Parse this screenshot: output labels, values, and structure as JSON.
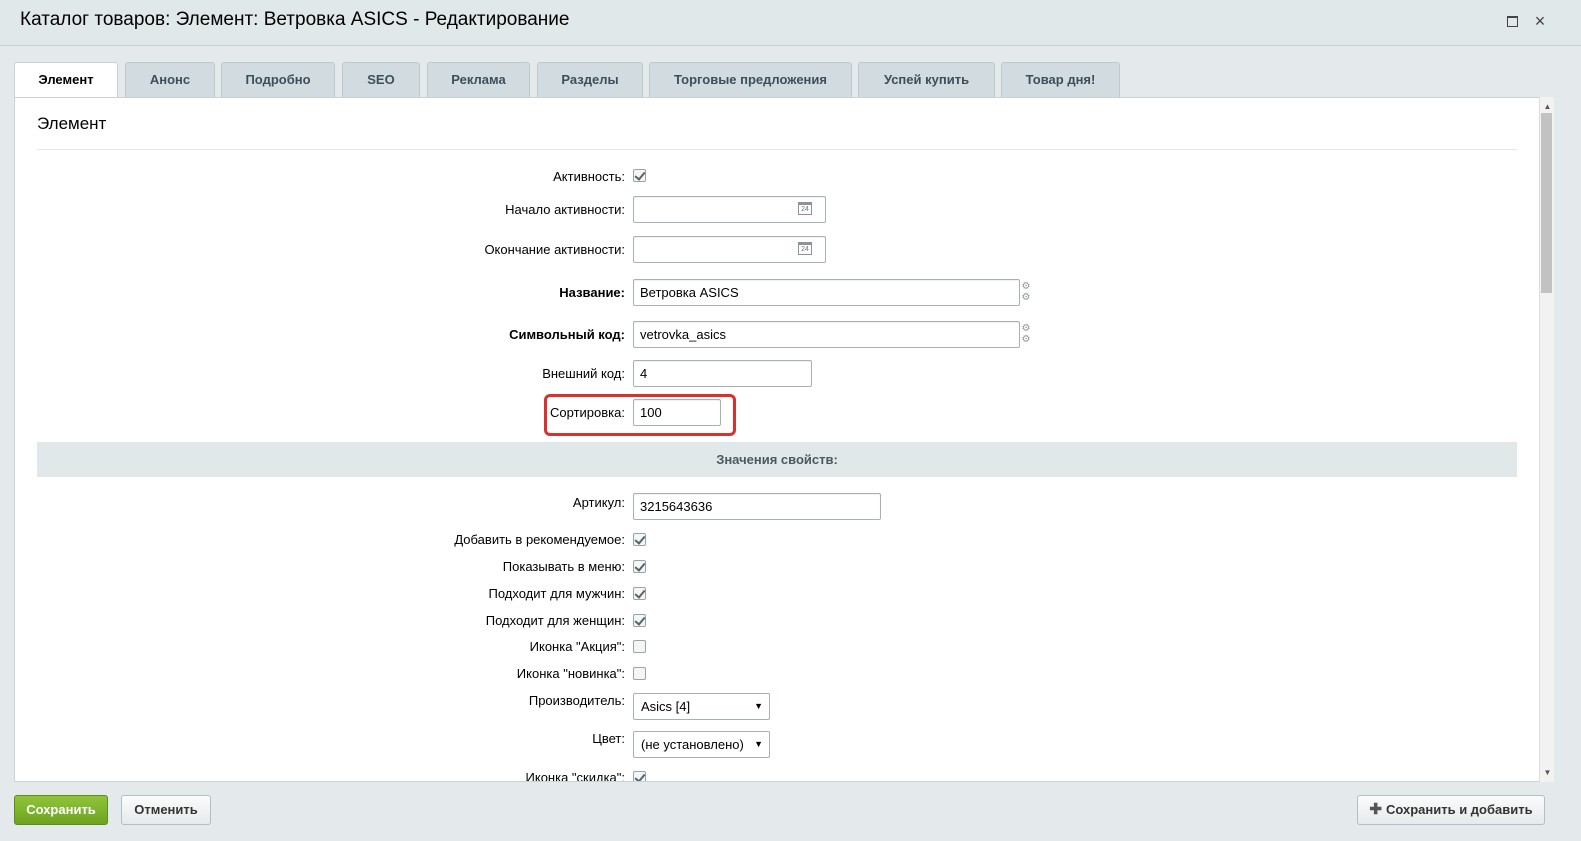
{
  "window": {
    "title": "Каталог товаров: Элемент: Ветровка ASICS - Редактирование",
    "maximize_icon": "maximize-icon",
    "close_icon": "close-icon",
    "close_glyph": "×"
  },
  "tabs": [
    {
      "label": "Элемент",
      "active": true
    },
    {
      "label": "Анонс"
    },
    {
      "label": "Подробно"
    },
    {
      "label": "SEO"
    },
    {
      "label": "Реклама"
    },
    {
      "label": "Разделы"
    },
    {
      "label": "Торговые предложения"
    },
    {
      "label": "Успей купить"
    },
    {
      "label": "Товар дня!"
    }
  ],
  "section": {
    "title": "Элемент"
  },
  "form": {
    "active": {
      "label": "Активность:",
      "checked": true
    },
    "active_from": {
      "label": "Начало активности:",
      "value": ""
    },
    "active_to": {
      "label": "Окончание активности:",
      "value": ""
    },
    "calendar_icon_text": "24",
    "name": {
      "label": "Название:",
      "value": "Ветровка ASICS"
    },
    "code": {
      "label": "Символьный код:",
      "value": "vetrovka_asics"
    },
    "external_code": {
      "label": "Внешний код:",
      "value": "4"
    },
    "sort": {
      "label": "Сортировка:",
      "value": "100"
    }
  },
  "properties": {
    "header": "Значения свойств:",
    "article": {
      "label": "Артикул:",
      "value": "3215643636"
    },
    "recommended": {
      "label": "Добавить в рекомендуемое:",
      "checked": true
    },
    "show_in_menu": {
      "label": "Показывать в меню:",
      "checked": true
    },
    "for_men": {
      "label": "Подходит для мужчин:",
      "checked": true
    },
    "for_women": {
      "label": "Подходит для женщин:",
      "checked": true
    },
    "icon_sale": {
      "label": "Иконка \"Акция\":",
      "checked": false
    },
    "icon_new": {
      "label": "Иконка \"новинка\":",
      "checked": false
    },
    "manufacturer": {
      "label": "Производитель:",
      "value": "Asics [4]"
    },
    "color": {
      "label": "Цвет:",
      "value": "(не установлено)"
    },
    "icon_discount": {
      "label": "Иконка \"скидка\":",
      "checked": true
    }
  },
  "footer": {
    "save": "Сохранить",
    "cancel": "Отменить",
    "save_and_add": "Сохранить и добавить",
    "plus_glyph": "✚"
  },
  "colors": {
    "accent_green": "#7ab32e",
    "highlight_red": "#d8312e"
  }
}
